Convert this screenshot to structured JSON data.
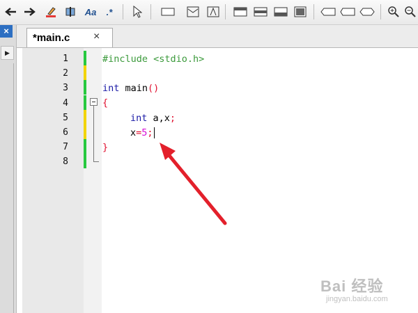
{
  "toolbar": {
    "aa_label": "Aa",
    "regex_label": ".*",
    "icons": [
      "back-icon",
      "forward-icon",
      "highlight-icon",
      "column-icon",
      "match-case",
      "regex",
      "pointer-icon",
      "rect-icon",
      "image-icon",
      "image-frame-icon",
      "layout-icon",
      "layout2-icon",
      "layout3-icon",
      "layout4-icon",
      "shape1-icon",
      "shape2-icon",
      "shape3-icon",
      "zoom-in-icon",
      "zoom-out-icon"
    ]
  },
  "left_panel": {
    "close_label": "×",
    "arrow_label": "▶"
  },
  "tab": {
    "label": "*main.c",
    "close_label": "×"
  },
  "editor": {
    "line_numbers": [
      "1",
      "2",
      "3",
      "4",
      "5",
      "6",
      "7",
      "8"
    ],
    "markers": [
      "#27c93f",
      "#f2d400",
      "#27c93f",
      "#27c93f",
      "#f2d400",
      "#f2d400",
      "#27c93f",
      "#27c93f"
    ],
    "lines": {
      "l1": "#include <stdio.h>",
      "l3_kw": "int",
      "l3_name": " main",
      "l3_paren": "()",
      "l4": "{",
      "l5_kw": "int",
      "l5_rest": " a,x",
      "l5_semi": ";",
      "l6_var": "x",
      "l6_eq": "=",
      "l6_num": "5",
      "l6_semi": ";",
      "l7": "}"
    }
  },
  "watermark": {
    "text": "Bai 经验",
    "sub": "jingyan.baidu.com"
  },
  "colors": {
    "annotation_arrow": "#e3202b",
    "keyword": "#1a1aa6",
    "preprocessor": "#3b9a3b"
  }
}
